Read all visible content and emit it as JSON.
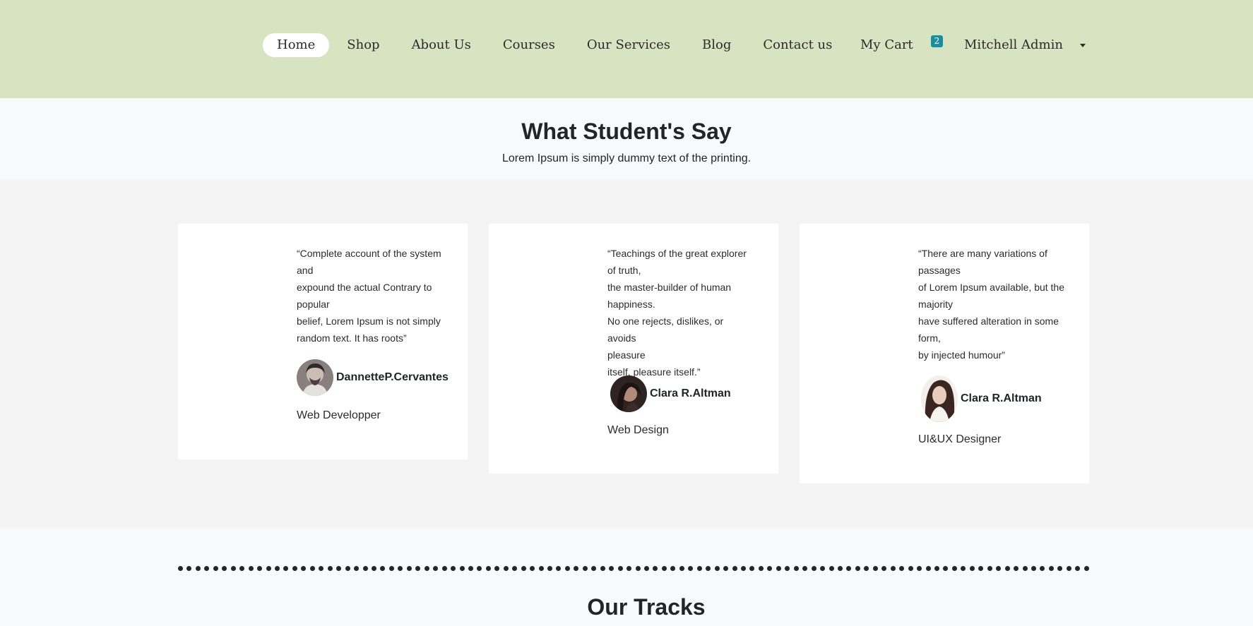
{
  "nav": {
    "items": [
      {
        "label": "Home",
        "active": true
      },
      {
        "label": "Shop"
      },
      {
        "label": "About Us"
      },
      {
        "label": "Courses"
      },
      {
        "label": "Our Services"
      },
      {
        "label": "Blog"
      },
      {
        "label": "Contact us"
      }
    ],
    "cart_label": "My Cart",
    "cart_count": "2",
    "user_label": "Mitchell Admin"
  },
  "testimonials": {
    "title": "What Student's Say",
    "subtitle": "Lorem Ipsum is simply dummy text of the printing.",
    "cards": [
      {
        "quote": [
          "“Complete account of the system",
          "and",
          "expound the actual Contrary to",
          "popular",
          "belief, Lorem Ipsum is not simply",
          "random text. It has roots”"
        ],
        "name": "DannetteP.Cervantes",
        "role": "Web Developper"
      },
      {
        "quote": [
          "“Teachings of the great explorer",
          "of truth,",
          "the master-builder of human",
          "happiness.",
          "No one rejects, dislikes, or avoids",
          "pleasure",
          "itself, pleasure itself.”"
        ],
        "name": "Clara R.Altman",
        "role": "Web Design"
      },
      {
        "quote": [
          "“There are many variations of",
          "passages",
          "of Lorem Ipsum available, but the",
          "majority",
          "have suffered alteration in some",
          "form,",
          "by injected humour”"
        ],
        "name": "Clara R.Altman",
        "role": "UI&UX Designer"
      }
    ]
  },
  "tracks": {
    "title": "Our Tracks"
  },
  "colors": {
    "header_bg": "#d8e4c1",
    "badge_bg": "#1f8c9a",
    "band_bg": "#f4f4f4"
  }
}
